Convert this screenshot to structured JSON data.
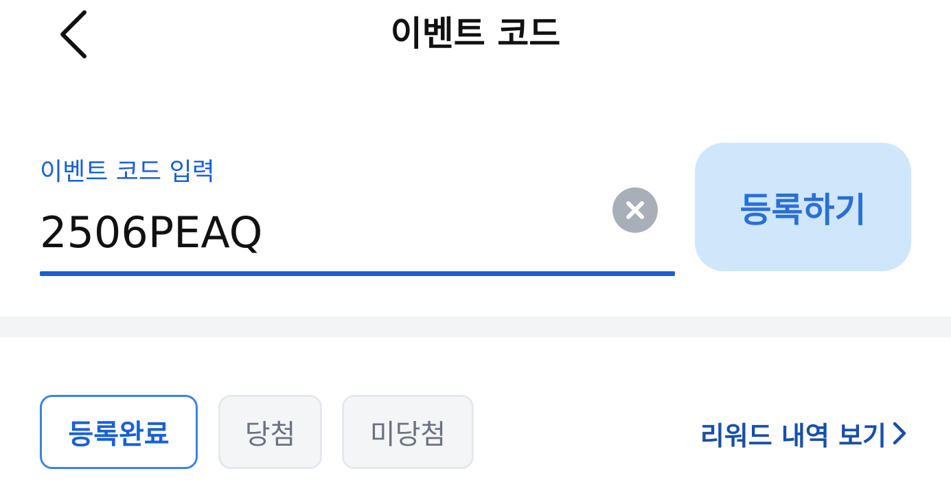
{
  "header": {
    "title": "이벤트 코드",
    "back_icon": "chevron-left-icon"
  },
  "form": {
    "label": "이벤트 코드 입력",
    "code_value": "2506PEAQ",
    "clear_icon": "clear-circle-icon",
    "register_label": "등록하기"
  },
  "filters": {
    "items": [
      {
        "label": "등록완료",
        "selected": true
      },
      {
        "label": "당첨",
        "selected": false
      },
      {
        "label": "미당첨",
        "selected": false
      }
    ],
    "reward_link_label": "리워드 내역 보기",
    "reward_link_icon": "chevron-right-icon"
  },
  "colors": {
    "accent": "#1a5fd6",
    "button_bg": "#cfe6fb",
    "button_text": "#2a6fd6",
    "clear_bg": "#a8afb9",
    "divider": "#f2f4f6"
  }
}
